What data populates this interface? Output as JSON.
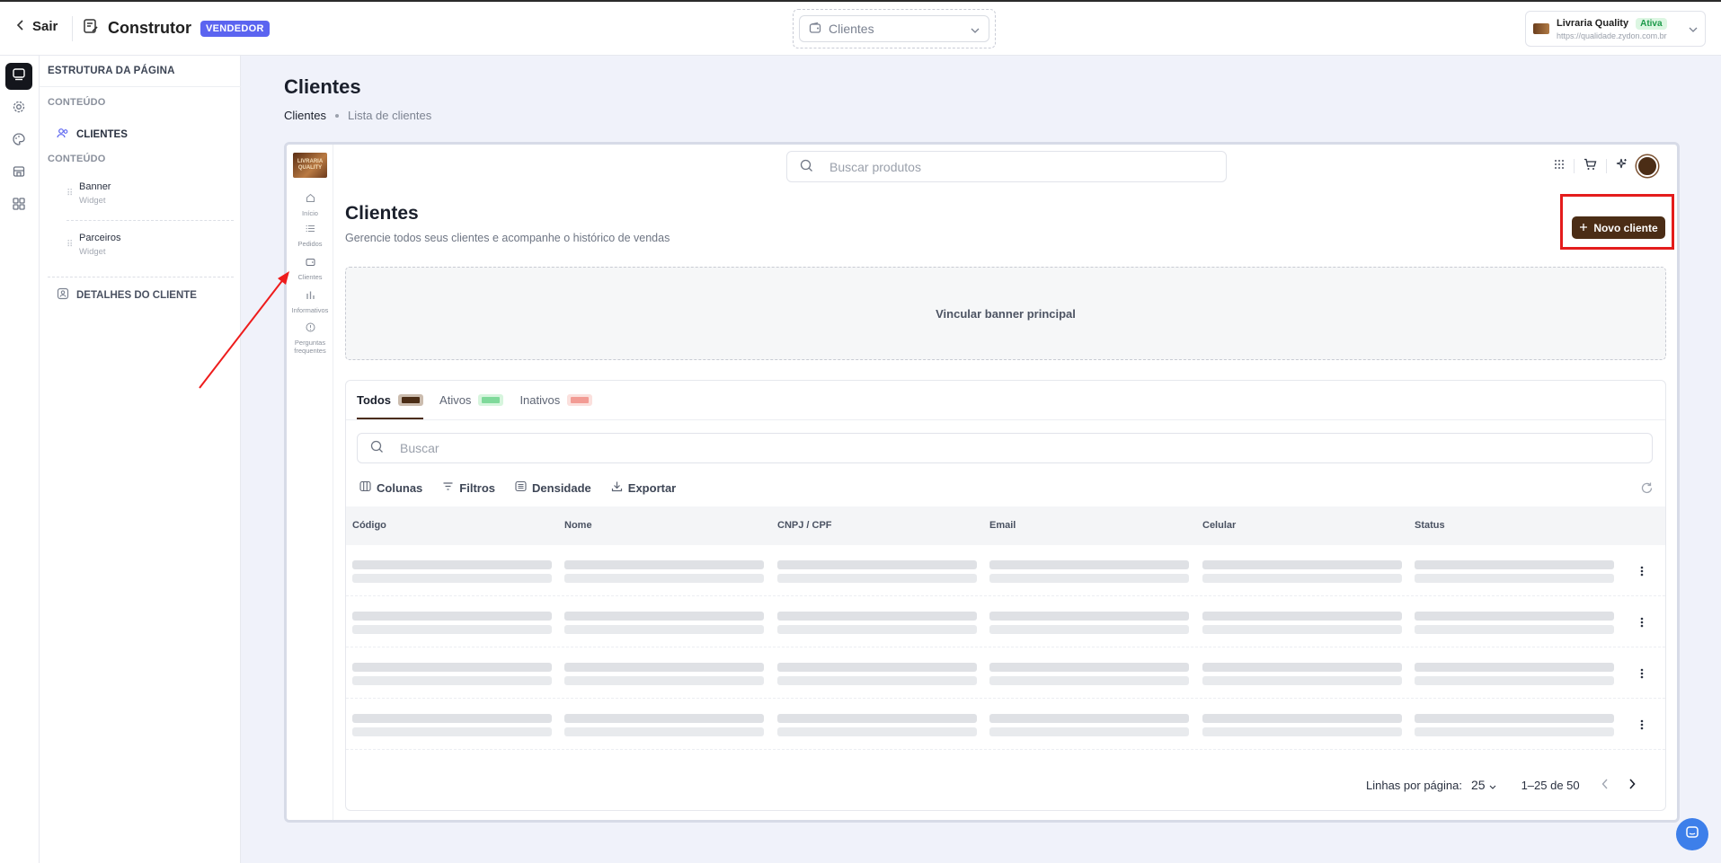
{
  "header": {
    "back_label": "Sair",
    "builder_title": "Construtor",
    "role_badge": "VENDEDOR",
    "page_select": "Clientes",
    "store": {
      "name": "Livraria Quality",
      "status": "Ativa",
      "url": "https://qualidade.zydon.com.br"
    }
  },
  "structure": {
    "title": "ESTRUTURA DA PÁGINA",
    "section1": "CONTEÚDO",
    "clientes_label": "CLIENTES",
    "section2": "CONTEÚDO",
    "widgets": [
      {
        "name": "Banner",
        "type": "Widget"
      },
      {
        "name": "Parceiros",
        "type": "Widget"
      }
    ],
    "details_label": "DETALHES DO CLIENTE"
  },
  "main": {
    "title": "Clientes",
    "breadcrumb": [
      "Clientes",
      "Lista de clientes"
    ]
  },
  "preview": {
    "logo_text": "LIVRARIA QUALITY",
    "nav": [
      "Início",
      "Pedidos",
      "Clientes",
      "Informativos",
      "Perguntas frequentes"
    ],
    "search_placeholder": "Buscar produtos",
    "title": "Clientes",
    "subtitle": "Gerencie todos seus clientes e acompanhe o histórico de vendas",
    "new_button": "Novo cliente",
    "banner_text": "Vincular banner principal",
    "tabs": [
      {
        "label": "Todos",
        "color": "#4b2d16"
      },
      {
        "label": "Ativos",
        "color": "#7fd99a"
      },
      {
        "label": "Inativos",
        "color": "#f29b94"
      }
    ],
    "list_search_placeholder": "Buscar",
    "toolbar": [
      "Colunas",
      "Filtros",
      "Densidade",
      "Exportar"
    ],
    "columns": [
      "Código",
      "Nome",
      "CNPJ / CPF",
      "Email",
      "Celular",
      "Status"
    ],
    "pagination": {
      "rows_label": "Linhas por página:",
      "rows_value": "25",
      "range": "1–25 de 50"
    }
  },
  "colors": {
    "accent": "#4b2d16",
    "vendor_badge": "#5b64f0",
    "highlight": "#e41c1c"
  }
}
